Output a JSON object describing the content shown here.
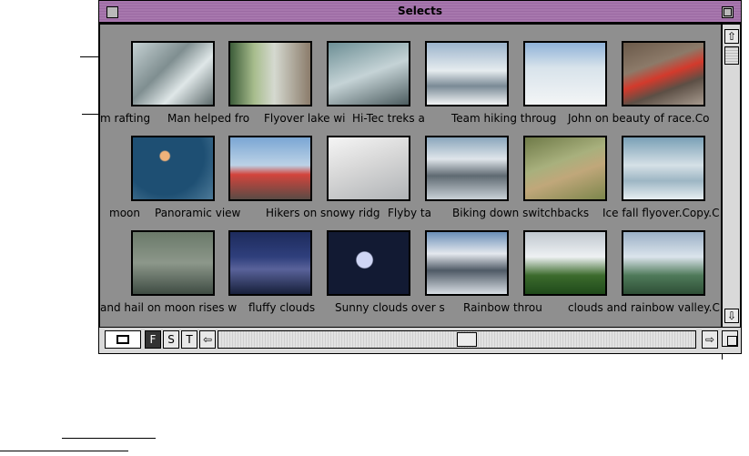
{
  "window": {
    "title": "Selects"
  },
  "toolbar": {
    "view_toggle_icon": "view-toggle-icon",
    "btn_f": "F",
    "btn_s": "S",
    "btn_t": "T"
  },
  "grid": {
    "rows": [
      {
        "captions": [
          "m rafting",
          "Man helped fro",
          "Flyover lake wi",
          "Hi-Tec treks a",
          "Team hiking throug",
          "John on beauty of race.Co"
        ]
      },
      {
        "captions": [
          "moon",
          "Panoramic view",
          "Hikers on snowy ridg",
          "Flyby ta",
          "Biking down switchbacks",
          "Ice fall flyover.Copy.C"
        ]
      },
      {
        "captions": [
          "and hail on moon rises w",
          "fluffy clouds",
          "Sunny clouds over s",
          "Rainbow throu",
          "clouds and rainbow valley.C",
          ""
        ]
      }
    ]
  },
  "colors": {
    "titlebar": "#a777ad",
    "content_bg": "#8f8f8f"
  }
}
